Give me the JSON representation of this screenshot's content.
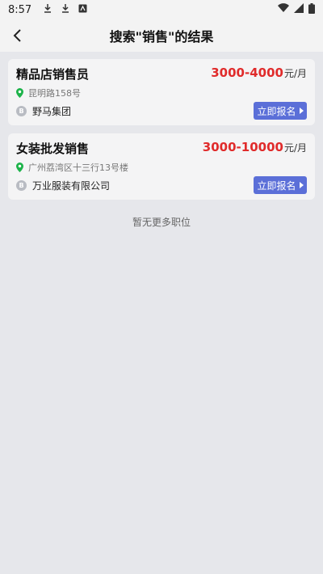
{
  "status_bar": {
    "time": "8:57"
  },
  "header": {
    "title": "搜索\"销售\"的结果"
  },
  "jobs": [
    {
      "title": "精品店销售员",
      "salary": "3000-4000",
      "unit": "元/月",
      "address": "昆明路158号",
      "company": "野马集团",
      "apply_label": "立即报名"
    },
    {
      "title": "女装批发销售",
      "salary": "3000-10000",
      "unit": "元/月",
      "address": "广州荔湾区十三行13号楼",
      "company": "万业服装有限公司",
      "apply_label": "立即报名"
    }
  ],
  "footer": {
    "no_more": "暂无更多职位"
  },
  "colors": {
    "accent": "#5b6fd8",
    "salary": "#e02b2b",
    "pin": "#1db34a"
  }
}
